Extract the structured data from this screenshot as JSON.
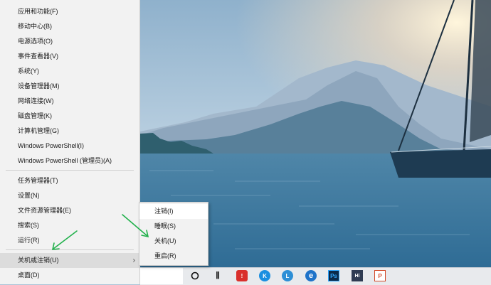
{
  "menu": {
    "group1": [
      {
        "id": "apps",
        "label": "应用和功能(F)"
      },
      {
        "id": "mobility",
        "label": "移动中心(B)"
      },
      {
        "id": "power",
        "label": "电源选项(O)"
      },
      {
        "id": "eventviewer",
        "label": "事件查看器(V)"
      },
      {
        "id": "system",
        "label": "系统(Y)"
      },
      {
        "id": "devicemanager",
        "label": "设备管理器(M)"
      },
      {
        "id": "network",
        "label": "网络连接(W)"
      },
      {
        "id": "disk",
        "label": "磁盘管理(K)"
      },
      {
        "id": "computermgmt",
        "label": "计算机管理(G)"
      },
      {
        "id": "powershell",
        "label": "Windows PowerShell(I)"
      },
      {
        "id": "powershell-admin",
        "label": "Windows PowerShell (管理员)(A)"
      }
    ],
    "group2": [
      {
        "id": "taskmanager",
        "label": "任务管理器(T)"
      },
      {
        "id": "settings",
        "label": "设置(N)"
      },
      {
        "id": "explorer",
        "label": "文件资源管理器(E)"
      },
      {
        "id": "search",
        "label": "搜索(S)"
      },
      {
        "id": "run",
        "label": "运行(R)"
      }
    ],
    "shutdown": {
      "label": "关机或注销(U)",
      "chevron": "›"
    },
    "desktop": {
      "label": "桌面(D)"
    }
  },
  "submenu": {
    "items": [
      {
        "id": "signout",
        "label": "注销(I)"
      },
      {
        "id": "sleep",
        "label": "睡眠(S)"
      },
      {
        "id": "shutdown",
        "label": "关机(U)"
      },
      {
        "id": "restart",
        "label": "重启(R)"
      }
    ]
  },
  "taskbar": {
    "icons": [
      {
        "name": "cortana-icon",
        "glyph": ""
      },
      {
        "name": "task-view-icon",
        "glyph": "⫼"
      },
      {
        "name": "app-red-icon",
        "glyph": "!",
        "color": "#d9302c"
      },
      {
        "name": "app-k-icon",
        "glyph": "K",
        "color": "#1b8fe0"
      },
      {
        "name": "app-l-icon",
        "glyph": "L",
        "color": "#2d8fd6"
      },
      {
        "name": "edge-icon",
        "glyph": "e",
        "color": "#1f73c9"
      },
      {
        "name": "photoshop-icon",
        "glyph": "Ps",
        "color": "#0b2a4a"
      },
      {
        "name": "app-dark-icon",
        "glyph": "Hi",
        "color": "#2f3b52"
      },
      {
        "name": "powerpoint-icon",
        "glyph": "P",
        "color": "#d24726"
      }
    ]
  },
  "colors": {
    "annotation_arrow": "#22b14c",
    "menu_bg": "#f2f2f2",
    "highlight": "#dcdcdc"
  }
}
